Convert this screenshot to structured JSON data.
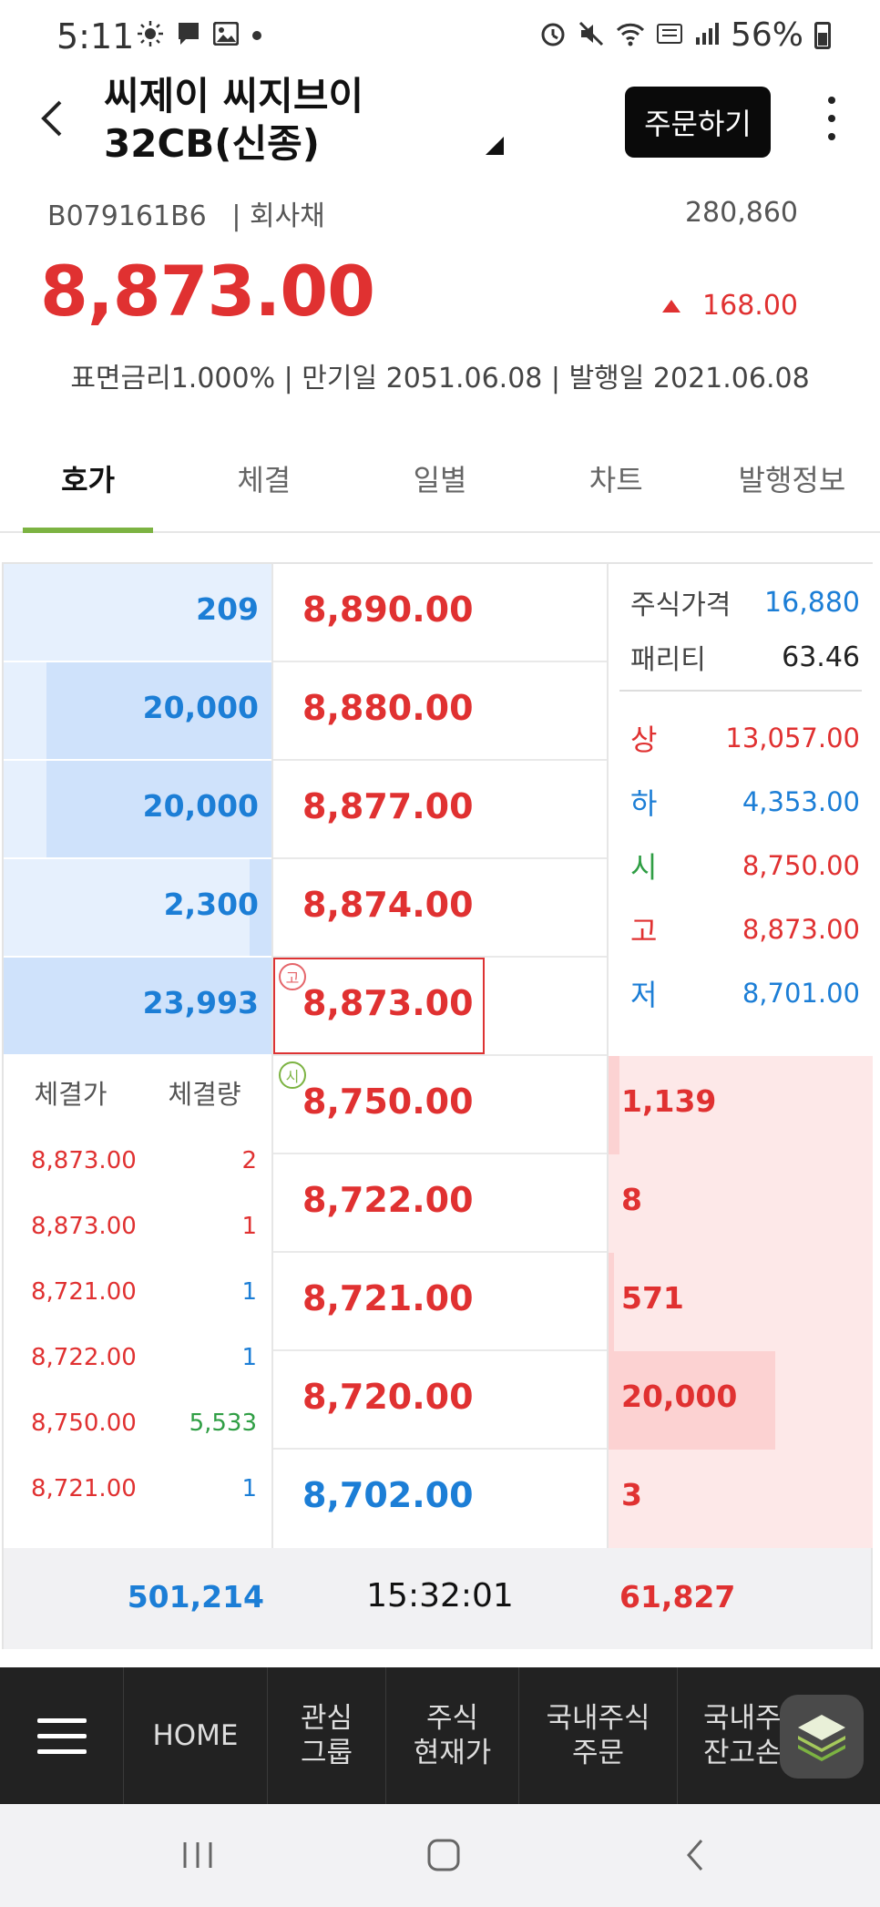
{
  "status_bar": {
    "time": "5:11",
    "battery": "56%",
    "left_icons": [
      "sun-icon",
      "chat-icon",
      "image-icon",
      "dot-icon"
    ],
    "right_icons": [
      "alarm-icon",
      "mute-icon",
      "wifi-icon",
      "hd-voice-icon",
      "signal-icon",
      "battery-icon"
    ]
  },
  "header": {
    "title": "씨제이 씨지브이32CB(신종)",
    "order_button": "주문하기"
  },
  "summary": {
    "code": "B079161B6",
    "type": "| 회사채",
    "volume": "280,860",
    "price": "8,873.00",
    "change": "168.00",
    "info": "표면금리1.000% | 만기일 2051.06.08 | 발행일 2021.06.08"
  },
  "tabs": [
    {
      "label": "호가",
      "active": true
    },
    {
      "label": "체결",
      "active": false
    },
    {
      "label": "일별",
      "active": false
    },
    {
      "label": "차트",
      "active": false
    },
    {
      "label": "발행정보",
      "active": false
    }
  ],
  "asks": [
    {
      "qty": "209",
      "price": "8,890.00",
      "fill": 0.0
    },
    {
      "qty": "20,000",
      "price": "8,880.00",
      "fill": 0.84
    },
    {
      "qty": "20,000",
      "price": "8,877.00",
      "fill": 0.84
    },
    {
      "qty": "2,300",
      "price": "8,874.00",
      "fill": 0.08
    },
    {
      "qty": "23,993",
      "price": "8,873.00",
      "fill": 1.0
    }
  ],
  "bids": [
    {
      "qty": "1,139",
      "price": "8,750.00",
      "fill": 0.04
    },
    {
      "qty": "8",
      "price": "8,722.00",
      "fill": 0.0
    },
    {
      "qty": "571",
      "price": "8,721.00",
      "fill": 0.02
    },
    {
      "qty": "20,000",
      "price": "8,720.00",
      "fill": 0.63
    },
    {
      "qty": "3",
      "price": "8,702.00",
      "fill": 0.0
    }
  ],
  "markers": {
    "high": "고",
    "open": "시"
  },
  "info_panel": {
    "stock_price_label": "주식가격",
    "stock_price": "16,880",
    "parity_label": "패리티",
    "parity": "63.46",
    "rows": [
      {
        "label": "상",
        "value": "13,057.00",
        "label_color": "#e03131",
        "value_color": "#e03131"
      },
      {
        "label": "하",
        "value": "4,353.00",
        "label_color": "#1c7ed6",
        "value_color": "#1c7ed6"
      },
      {
        "label": "시",
        "value": "8,750.00",
        "label_color": "#2f9e44",
        "value_color": "#e03131"
      },
      {
        "label": "고",
        "value": "8,873.00",
        "label_color": "#e03131",
        "value_color": "#e03131"
      },
      {
        "label": "저",
        "value": "8,701.00",
        "label_color": "#1c7ed6",
        "value_color": "#1c7ed6"
      }
    ]
  },
  "trades": {
    "price_header": "체결가",
    "qty_header": "체결량",
    "rows": [
      {
        "price": "8,873.00",
        "qty": "2",
        "color": "#e03131"
      },
      {
        "price": "8,873.00",
        "qty": "1",
        "color": "#e03131"
      },
      {
        "price": "8,721.00",
        "qty": "1",
        "color": "#1c7ed6"
      },
      {
        "price": "8,722.00",
        "qty": "1",
        "color": "#1c7ed6"
      },
      {
        "price": "8,750.00",
        "qty": "5,533",
        "color": "#2f9e44"
      },
      {
        "price": "8,721.00",
        "qty": "1",
        "color": "#1c7ed6"
      }
    ]
  },
  "totals": {
    "ask_total": "501,214",
    "time": "15:32:01",
    "bid_total": "61,827"
  },
  "bottom_nav": {
    "items": [
      "HOME",
      "관심\n그룹",
      "주식\n현재가",
      "국내주식\n주문",
      "국내주식\n잔고손익"
    ]
  },
  "colors": {
    "up": "#e03131",
    "down": "#1c7ed6",
    "accent": "#7cb342"
  }
}
